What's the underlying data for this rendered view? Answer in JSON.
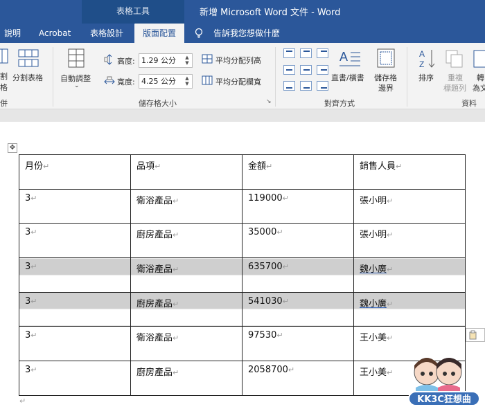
{
  "window": {
    "title": "新增 Microsoft Word 文件  -  Word",
    "context_group": "表格工具"
  },
  "tabs": [
    {
      "label": "說明"
    },
    {
      "label": "Acrobat"
    },
    {
      "label": "表格設計"
    },
    {
      "label": "版面配置"
    },
    {
      "label": "告訴我您想做什麼"
    }
  ],
  "ribbon": {
    "merge": {
      "cut_label_top": "割",
      "cut_label_bottom": "格",
      "split_table": "分割表格",
      "group": "併"
    },
    "cell_size": {
      "autofit": "自動調整",
      "height_label": "高度:",
      "height_value": "1.29 公分",
      "width_label": "寬度:",
      "width_value": "4.25 公分",
      "distribute_rows": "平均分配列高",
      "distribute_cols": "平均分配欄寬",
      "group": "儲存格大小"
    },
    "alignment": {
      "text_direction": "直書/橫書",
      "margins_top": "儲存格",
      "margins_bottom": "邊界",
      "group": "對齊方式"
    },
    "data": {
      "sort": "排序",
      "repeat_top": "重複",
      "repeat_bottom": "標題列",
      "convert_top": "轉",
      "convert_bottom": "為文",
      "group": "資料"
    }
  },
  "table": {
    "headers": [
      "月份",
      "品項",
      "金額",
      "銷售人員"
    ],
    "rows": [
      [
        "3",
        "衛浴產品",
        "119000",
        "張小明"
      ],
      [
        "3",
        "廚房產品",
        "35000",
        "張小明"
      ],
      [
        "3",
        "衛浴產品",
        "635700",
        "魏小廣"
      ],
      [
        "3",
        "廚房產品",
        "541030",
        "魏小廣"
      ],
      [
        "3",
        "衛浴產品",
        "97530",
        "王小美"
      ],
      [
        "3",
        "廚房產品",
        "2058700",
        "王小美"
      ]
    ],
    "end_mark": "↵"
  },
  "watermark": {
    "text": "KK3C狂想曲"
  },
  "colors": {
    "brand": "#2b579a",
    "selection": "#cfcfcf"
  }
}
